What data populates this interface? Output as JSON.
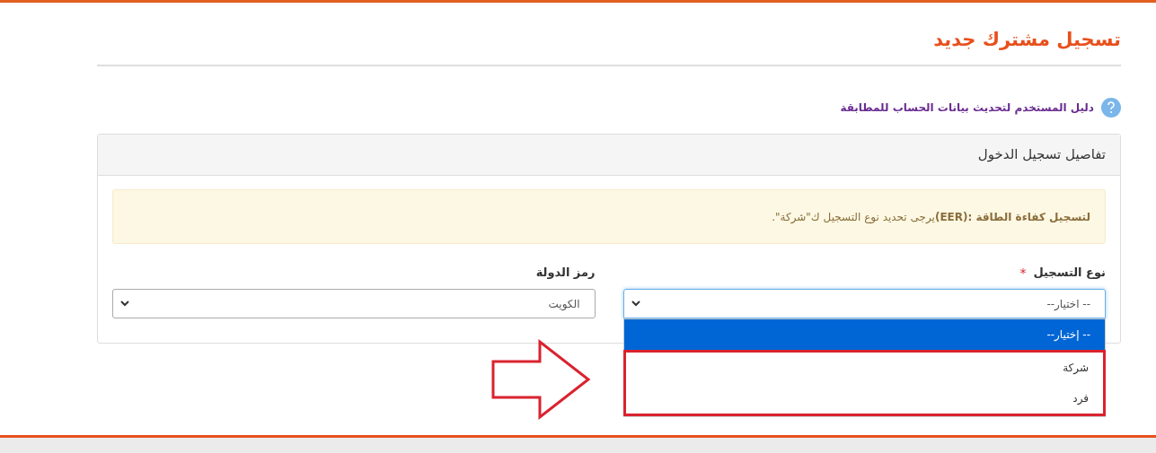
{
  "page_title": "تسجيل مشترك جديد",
  "help_link": "دليل المستخدم لتحديث بيانات الحساب للمطابقة",
  "panel": {
    "title": "تفاصيل تسجيل الدخول",
    "alert": "**لتسجيل كفاءة الطاقة :(EER)**يرجى تحديد نوع التسجيل ك\"شركة\".",
    "fields": [
      {
        "label": "نوع التسجيل",
        "required_mark": "*",
        "value": "-- اختيار--",
        "focused": true,
        "expanded": true,
        "options": [
          {
            "label": "-- إختيار--",
            "selected": true
          },
          {
            "label": "شركة",
            "selected": false
          },
          {
            "label": "فرد",
            "selected": false
          }
        ]
      },
      {
        "label": "رمز الدولة",
        "value": "الكويت",
        "focused": false,
        "expanded": false
      }
    ]
  }
}
